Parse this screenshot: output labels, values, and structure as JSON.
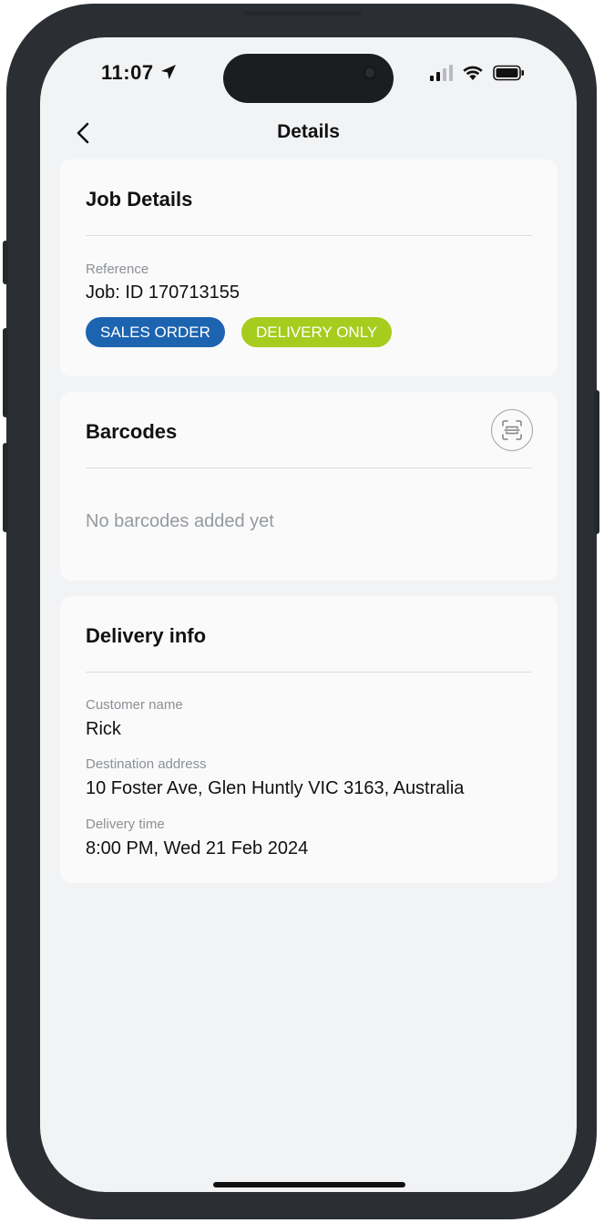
{
  "status_bar": {
    "time": "11:07",
    "icons": [
      "location-arrow-icon",
      "cellular-signal-icon",
      "wifi-icon",
      "battery-icon"
    ]
  },
  "nav": {
    "title": "Details",
    "back_icon": "chevron-left-icon"
  },
  "job_details": {
    "title": "Job Details",
    "reference_label": "Reference",
    "reference_value": "Job: ID 170713155",
    "badges": [
      {
        "label": "SALES ORDER",
        "color": "#1d64b0"
      },
      {
        "label": "DELIVERY ONLY",
        "color": "#a6cc1e"
      }
    ]
  },
  "barcodes": {
    "title": "Barcodes",
    "scan_icon": "barcode-scan-icon",
    "empty_text": "No barcodes added yet"
  },
  "delivery_info": {
    "title": "Delivery info",
    "fields": [
      {
        "label": "Customer name",
        "value": "Rick"
      },
      {
        "label": "Destination address",
        "value": "10 Foster Ave, Glen Huntly VIC 3163, Australia"
      },
      {
        "label": "Delivery time",
        "value": "8:00 PM, Wed 21 Feb 2024"
      }
    ]
  },
  "colors": {
    "frame": "#2b2e32",
    "screen_bg": "#f2f3f5",
    "card_bg": "#fafafa"
  }
}
